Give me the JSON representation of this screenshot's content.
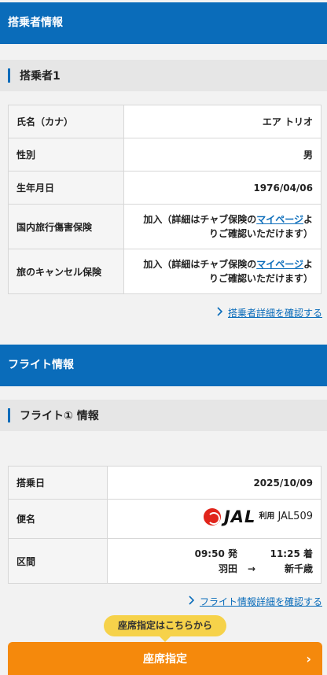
{
  "passenger_section": {
    "title": "搭乗者情報",
    "sub_title": "搭乗者1",
    "rows": [
      {
        "label": "氏名（カナ）",
        "value": "エア トリオ"
      },
      {
        "label": "性別",
        "value": "男"
      },
      {
        "label": "生年月日",
        "value": "1976/04/06"
      }
    ],
    "insurance_domestic": {
      "label": "国内旅行傷害保険",
      "prefix": "加入（詳細はチャブ保険の",
      "link": "マイページ",
      "suffix_1": "よ",
      "suffix_2": "りご確認いただけます）"
    },
    "insurance_cancel": {
      "label": "旅のキャンセル保険",
      "prefix": "加入（詳細はチャブ保険の",
      "link": "マイページ",
      "suffix_1": "よ",
      "suffix_2": "りご確認いただけます）"
    },
    "detail_link": "搭乗者詳細を確認する"
  },
  "flight_section": {
    "title": "フライト情報",
    "sub_title": "フライト① 情報",
    "date_label": "搭乗日",
    "date_value": "2025/10/09",
    "flight_label": "便名",
    "airline_logo_text": "JAL",
    "airline_use": "利用",
    "flight_number": "JAL509",
    "route_label": "区間",
    "dep_time": "09:50",
    "dep_suffix": "発",
    "arr_time": "11:25",
    "arr_suffix": "着",
    "dep_airport": "羽田",
    "arrow": "→",
    "arr_airport": "新千歳",
    "detail_link": "フライト情報詳細を確認する"
  },
  "seat": {
    "tooltip": "座席指定はこちらから",
    "button_label": "座席指定",
    "button_arrow": "›"
  },
  "icons": {
    "link_chevron": "chevron-right-icon",
    "jal_logo": "jal-crane-icon"
  },
  "colors": {
    "band_blue": "#0a6cba",
    "accent_orange": "#f5890c",
    "tooltip_yellow": "#f6d24a",
    "jal_red": "#e1251b"
  }
}
